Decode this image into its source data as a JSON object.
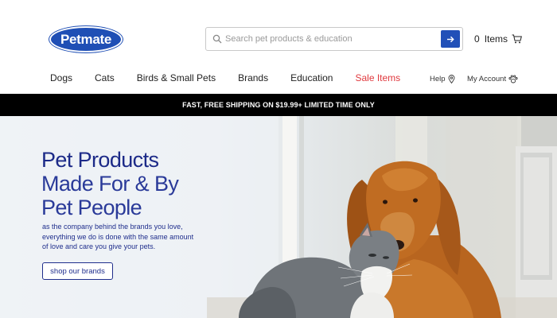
{
  "header": {
    "logo_text": "Petmate",
    "search": {
      "placeholder": "Search pet products & education"
    },
    "cart": {
      "count": "0",
      "label": "Items"
    }
  },
  "nav": {
    "items": [
      {
        "label": "Dogs"
      },
      {
        "label": "Cats"
      },
      {
        "label": "Birds & Small Pets"
      },
      {
        "label": "Brands"
      },
      {
        "label": "Education"
      },
      {
        "label": "Sale Items"
      }
    ],
    "help_label": "Help",
    "account_label": "My Account"
  },
  "promo": {
    "text": "FAST, FREE SHIPPING ON $19.99+ LIMITED TIME ONLY"
  },
  "hero": {
    "title_line1": "Pet Products",
    "title_line2": "Made For & By",
    "title_line3": "Pet People",
    "body_lines": [
      "as the company behind the brands you love,",
      "everything we do is done with the same amount",
      "of love and care you give your pets."
    ],
    "cta_label": "shop our brands"
  },
  "colors": {
    "brand_blue": "#1f4fb5",
    "hero_text": "#1f2e8c",
    "sale_red": "#e0393e",
    "promo_bg": "#000000"
  }
}
